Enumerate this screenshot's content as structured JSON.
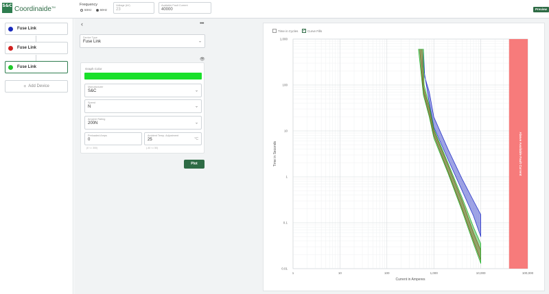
{
  "header": {
    "logo_text": "S&C",
    "brand": "Coordinaide",
    "brand_mark": "TM",
    "frequency_label": "Frequency",
    "freq_options": [
      {
        "label": "50Hz",
        "selected": false
      },
      {
        "label": "60Hz",
        "selected": true
      }
    ],
    "voltage_field": {
      "label": "Voltage (kV)",
      "value": "23"
    },
    "fault_field": {
      "label": "Available Fault Current",
      "value": "40000"
    },
    "preview_label": "Preview"
  },
  "devices": [
    {
      "name": "Fuse Link",
      "color": "#1a2bbd",
      "active": false
    },
    {
      "name": "Fuse Link",
      "color": "#d1201f",
      "active": false
    },
    {
      "name": "Fuse Link",
      "color": "#1ec829",
      "active": true
    }
  ],
  "add_device_label": "Add Device",
  "form": {
    "device_type": {
      "label": "Device Type",
      "value": "Fuse Link"
    },
    "graph_color_label": "Graph Color",
    "graph_color": "#19e02a",
    "manufacturer": {
      "label": "Manufacturer",
      "value": "S&C"
    },
    "speed": {
      "label": "Speed",
      "value": "N"
    },
    "ampere_rating": {
      "label": "Ampere Rating",
      "value": "200N"
    },
    "preloaded": {
      "label": "Preloaded Amps",
      "value": "0",
      "hint": "(0 <= 300)"
    },
    "ambient": {
      "label": "Ambient Temp. Adjustment",
      "value": "25",
      "suffix": "°C",
      "hint": "(-40 <= 50)"
    },
    "plot_label": "Plot"
  },
  "chart_controls": {
    "time_in_cycles": {
      "label": "Time in Cycles",
      "checked": false
    },
    "curve_fills": {
      "label": "Curve Fills",
      "checked": true
    }
  },
  "chart_data": {
    "type": "area",
    "scale": "log-log",
    "xlabel": "Current in Amperes",
    "ylabel": "Time in Seconds",
    "xlim": [
      1,
      100000
    ],
    "ylim": [
      0.01,
      1000
    ],
    "x_ticks": [
      "1",
      "10",
      "100",
      "1,000",
      "10,000",
      "100,000"
    ],
    "y_ticks": [
      "0.01",
      "0.1",
      "1",
      "10",
      "100",
      "1,000"
    ],
    "grid": true,
    "fault_band": {
      "x_start": 40000,
      "x_end": 100000,
      "label": "Above Available Fault Current",
      "color": "#f77b7b"
    },
    "series": [
      {
        "color": "#2a36c8",
        "upper": [
          [
            600,
            600
          ],
          [
            640,
            150
          ],
          [
            800,
            70
          ],
          [
            1000,
            20
          ],
          [
            2000,
            4
          ],
          [
            4000,
            0.9
          ],
          [
            7000,
            0.3
          ],
          [
            10000,
            0.15
          ]
        ],
        "lower": [
          [
            600,
            250
          ],
          [
            800,
            40
          ],
          [
            1000,
            12
          ],
          [
            2000,
            2.4
          ],
          [
            4000,
            0.5
          ],
          [
            7000,
            0.14
          ],
          [
            10000,
            0.05
          ]
        ]
      },
      {
        "color": "#d1201f",
        "upper": [
          [
            560,
            600
          ],
          [
            600,
            90
          ],
          [
            800,
            30
          ],
          [
            1000,
            10
          ],
          [
            2000,
            1.8
          ],
          [
            4000,
            0.3
          ],
          [
            7000,
            0.06
          ],
          [
            10000,
            0.025
          ]
        ],
        "lower": [
          [
            500,
            600
          ],
          [
            600,
            70
          ],
          [
            800,
            22
          ],
          [
            1000,
            8
          ],
          [
            2000,
            1.3
          ],
          [
            4000,
            0.2
          ],
          [
            7000,
            0.04
          ],
          [
            10000,
            0.015
          ]
        ]
      },
      {
        "color": "#27b431",
        "upper": [
          [
            600,
            600
          ],
          [
            620,
            100
          ],
          [
            800,
            35
          ],
          [
            1000,
            11
          ],
          [
            2000,
            2
          ],
          [
            4000,
            0.35
          ],
          [
            7000,
            0.08
          ],
          [
            10000,
            0.035
          ]
        ],
        "lower": [
          [
            470,
            600
          ],
          [
            600,
            60
          ],
          [
            800,
            20
          ],
          [
            1000,
            7
          ],
          [
            2000,
            1.2
          ],
          [
            4000,
            0.18
          ],
          [
            7000,
            0.035
          ],
          [
            10000,
            0.013
          ]
        ]
      }
    ]
  }
}
